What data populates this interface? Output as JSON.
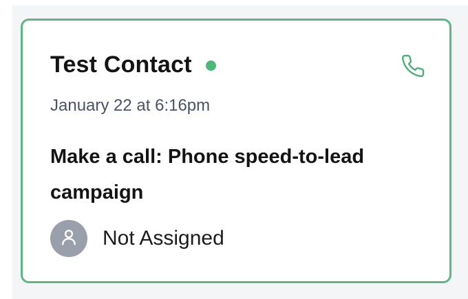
{
  "card": {
    "contact_name": "Test Contact",
    "status": "online",
    "timestamp": "January 22 at 6:16pm",
    "task_title": "Make a call: Phone speed-to-lead campaign",
    "assignee": "Not Assigned",
    "icons": {
      "action": "phone-icon",
      "avatar": "user-icon"
    }
  },
  "colors": {
    "accent": "#5cb785",
    "status_dot": "#4cb87a",
    "avatar_bg": "#9aa0ab"
  }
}
